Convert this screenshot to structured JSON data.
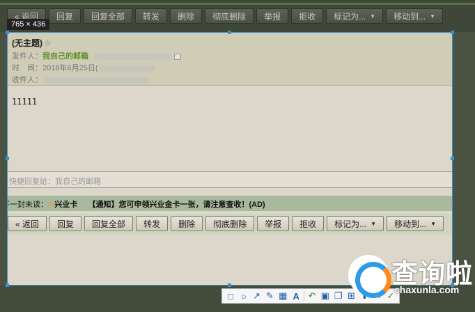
{
  "toolbar": {
    "back": "« 返回",
    "reply": "回复",
    "reply_all": "回复全部",
    "forward": "转发",
    "delete": "删除",
    "delete_forever": "彻底删除",
    "report": "举报",
    "reject": "拒收",
    "mark_as": "标记为...",
    "move_to": "移动到..."
  },
  "capture": {
    "size_label": "765 × 436"
  },
  "mail": {
    "subject": "(无主题)",
    "sender_label": "发件人：",
    "sender_name": "我自己的邮箱",
    "time_label": "时　间：",
    "time_value": "2018年6月25日(",
    "recipient_label": "收件人：",
    "body": "11111"
  },
  "quick_reply": {
    "placeholder": "快捷回复给：我自己的邮箱"
  },
  "next_mail": {
    "label": "下一封未读：",
    "sender": "兴业卡",
    "subject": "【通知】您可申领兴业金卡一张，请注意查收！(AD)"
  },
  "watermark": {
    "text": "查询啦",
    "domain": "chaxunla.com"
  },
  "icons": [
    "rect-tool-icon",
    "ellipse-tool-icon",
    "arrow-tool-icon",
    "pen-tool-icon",
    "mosaic-tool-icon",
    "text-tool-icon",
    "undo-icon",
    "save-icon",
    "copy-icon",
    "pin-icon",
    "cancel-icon",
    "confirm-icon"
  ]
}
